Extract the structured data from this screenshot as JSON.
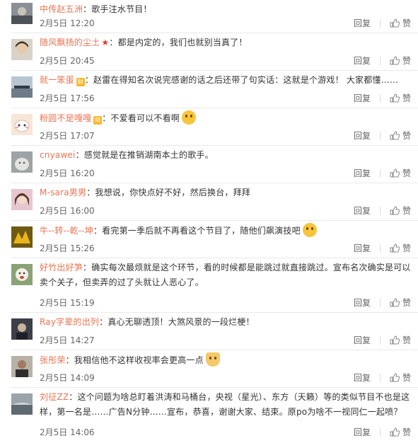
{
  "actions": {
    "reply": "回复",
    "like": "赞"
  },
  "comments": [
    {
      "user": "中传赵五洲",
      "badge": "",
      "text": "：歌手注水节目！",
      "emoji": "",
      "time": "2月5日 12:20"
    },
    {
      "user": "随风飘扬的尘土",
      "badge": "star",
      "text": "：都是内定的，我们也就别当真了！",
      "emoji": "",
      "time": "2月5日 20:45"
    },
    {
      "user": "就一笨蛋",
      "badge": "vip",
      "text": "：赵雷在得知名次说完感谢的话之后还带了句实话：这就是个游戏！ 大家都懂……",
      "emoji": "",
      "time": "2月5日 17:56"
    },
    {
      "user": "粉圆不是嘎嘎",
      "badge": "vip",
      "text": "：不爱看可以不看啊",
      "emoji": "laugh",
      "time": "2月5日 17:07"
    },
    {
      "user": "cnyawei",
      "badge": "",
      "text": "：感觉就是在推销湖南本土的歌手。",
      "emoji": "",
      "time": "2月5日 16:20"
    },
    {
      "user": "M-sara男男",
      "badge": "",
      "text": "：我想说，你快点好不好，然后换台，拜拜",
      "emoji": "",
      "time": "2月5日 16:00"
    },
    {
      "user": "牛--转--乾--坤",
      "badge": "",
      "text": "：看完第一季后就不再看这个节目了，随他们飙演技吧",
      "emoji": "shy",
      "time": "2月5日 15:26"
    },
    {
      "user": "好竹出好笋",
      "badge": "",
      "text": "：确实每次最烦就是这个环节，看的时候都是能跳过就直接跳过。宣布名次确实是可以卖个关子，但卖弄的过了头就让人恶心了。",
      "emoji": "",
      "time": "2月5日 15:19"
    },
    {
      "user": "Ray字辈的出列",
      "badge": "",
      "text": "：真心无聊透顶！大煞风景的一段烂梗！",
      "emoji": "",
      "time": "2月5日 14:27"
    },
    {
      "user": "张彤荣",
      "badge": "",
      "text": "：我相信他不这样收视率会更高一点",
      "emoji": "cat",
      "time": "2月5日 14:09"
    },
    {
      "user": "刘征ZZ",
      "badge": "",
      "text": "：这个问题为啥总盯着洪涛和马桶台，央视（星光）、东方（天籁）等的类似节目不也是这样，第一名是……广告N分钟……宣布，恭喜，谢谢大家、结束。原po为啥不一视同仁一起喷？",
      "emoji": "",
      "time": "2月5日 14:06"
    }
  ]
}
